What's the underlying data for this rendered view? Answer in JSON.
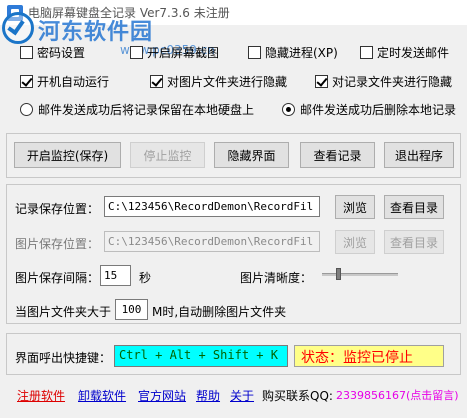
{
  "window": {
    "title": "电脑屏幕键盘全记录  Ver7.3.6  未注册"
  },
  "watermark": {
    "brand": "河东软件园",
    "url": "www.pc0359.cn"
  },
  "options": [
    {
      "label": "密码设置",
      "checked": false
    },
    {
      "label": "开启屏幕截图",
      "checked": false
    },
    {
      "label": "隐藏进程(XP)",
      "checked": false
    },
    {
      "label": "定时发送邮件",
      "checked": false
    },
    {
      "label": "开机自动运行",
      "checked": true
    },
    {
      "label": "对图片文件夹进行隐藏",
      "checked": true
    },
    {
      "label": "对记录文件夹进行隐藏",
      "checked": true
    }
  ],
  "radios": [
    {
      "label": "邮件发送成功后将记录保留在本地硬盘上",
      "checked": false
    },
    {
      "label": "邮件发送成功后删除本地记录",
      "checked": true
    }
  ],
  "actions": {
    "start": "开启监控(保存)",
    "stop": "停止监控",
    "hide": "隐藏界面",
    "view": "查看记录",
    "exit": "退出程序"
  },
  "paths": {
    "record_label": "记录保存位置：",
    "record_value": "C:\\123456\\RecordDemon\\RecordFil",
    "image_label": "图片保存位置：",
    "image_value": "C:\\123456\\RecordDemon\\RecordFil",
    "browse": "浏览",
    "open_dir": "查看目录"
  },
  "capture": {
    "interval_label": "图片保存间隔：",
    "interval_value": "15",
    "interval_unit": "秒",
    "clarity_label": "图片清晰度：",
    "clarity_level": 0.2,
    "limit_prefix": "当图片文件夹大于",
    "limit_value": "100",
    "limit_suffix": "M时,自动删除图片文件夹"
  },
  "hotkey": {
    "label": "界面呼出快捷键：",
    "value": "Ctrl + Alt + Shift + K",
    "status": "状态：监控已停止"
  },
  "footer": {
    "register": "注册软件",
    "uninstall": "卸载软件",
    "website": "官方网站",
    "help": "帮助",
    "about": "关于",
    "contact_label": "购买联系QQ:",
    "qq": "2339856167(点击留言)"
  },
  "colors": {
    "hotkey_bg": "#00ffff",
    "status_bg": "#ffff88",
    "status_text": "#ff0000",
    "link": "#0000cc",
    "register_link": "#dd0000",
    "qq": "#e600e6"
  }
}
